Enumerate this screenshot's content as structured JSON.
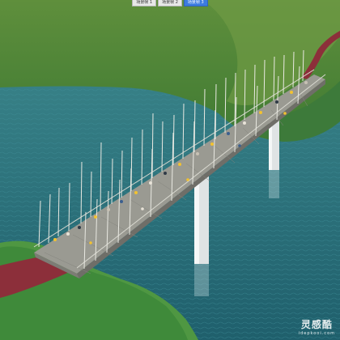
{
  "tabs": [
    {
      "label": "场景帧 1",
      "active": false
    },
    {
      "label": "场景帧 2",
      "active": false
    },
    {
      "label": "场景帧 3",
      "active": true
    }
  ],
  "watermark": {
    "brand": "灵感酷",
    "url": "idepkooi.com"
  },
  "colors": {
    "water": "#2b6e7a",
    "grass": "#4f8f3d",
    "deck": "#9a9a92",
    "path": "#8c2f3a",
    "tab_active": "#3c7be0"
  }
}
